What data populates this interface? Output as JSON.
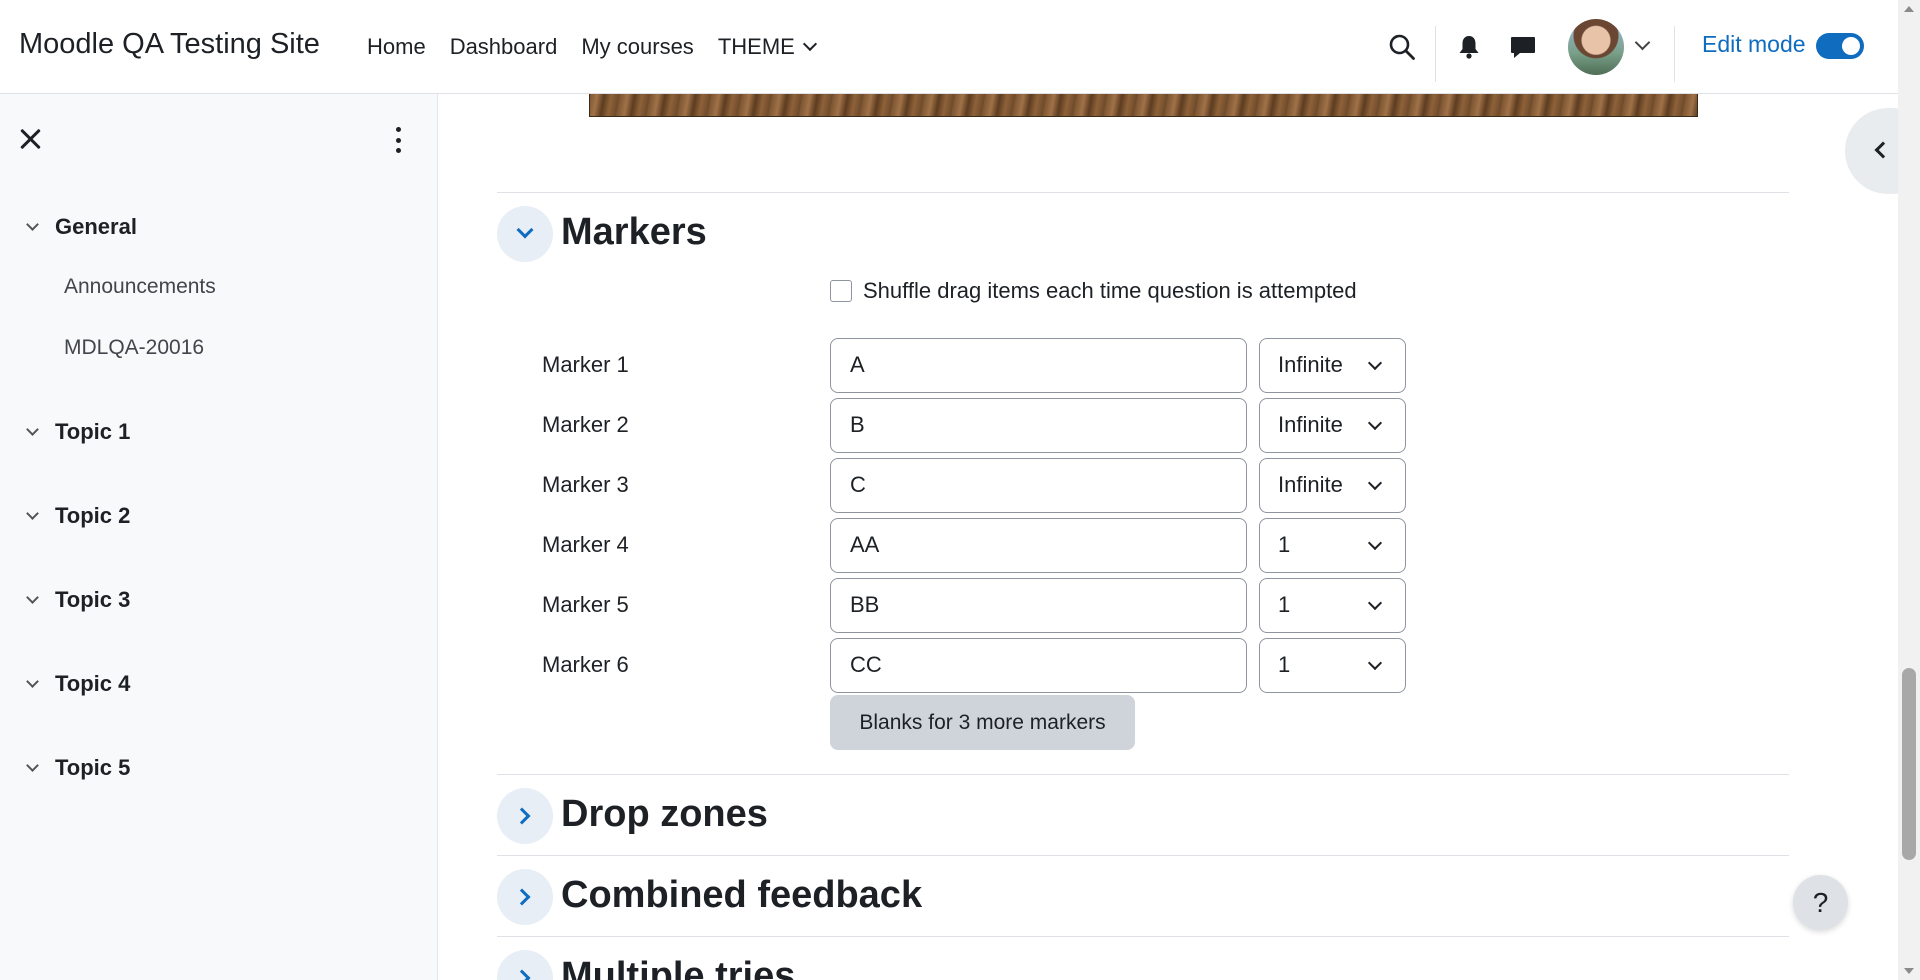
{
  "site": {
    "name": "Moodle QA Testing Site"
  },
  "nav": {
    "items": [
      {
        "label": "Home"
      },
      {
        "label": "Dashboard"
      },
      {
        "label": "My courses"
      },
      {
        "label": "THEME"
      }
    ],
    "edit_mode_label": "Edit mode",
    "edit_mode_on": true
  },
  "drawer": {
    "sections": [
      {
        "label": "General",
        "activities": [
          "Announcements",
          "MDLQA-20016"
        ]
      },
      {
        "label": "Topic 1"
      },
      {
        "label": "Topic 2"
      },
      {
        "label": "Topic 3"
      },
      {
        "label": "Topic 4"
      },
      {
        "label": "Topic 5"
      }
    ]
  },
  "markers_section": {
    "heading": "Markers",
    "shuffle_label": "Shuffle drag items each time question is attempted",
    "shuffle_checked": false,
    "markers": [
      {
        "label": "Marker 1",
        "value": "A",
        "count": "Infinite"
      },
      {
        "label": "Marker 2",
        "value": "B",
        "count": "Infinite"
      },
      {
        "label": "Marker 3",
        "value": "C",
        "count": "Infinite"
      },
      {
        "label": "Marker 4",
        "value": "AA",
        "count": "1"
      },
      {
        "label": "Marker 5",
        "value": "BB",
        "count": "1"
      },
      {
        "label": "Marker 6",
        "value": "CC",
        "count": "1"
      }
    ],
    "blanks_button": "Blanks for 3 more markers"
  },
  "collapsed_sections": [
    {
      "heading": "Drop zones"
    },
    {
      "heading": "Combined feedback"
    },
    {
      "heading": "Multiple tries"
    }
  ],
  "help_label": "?",
  "colors": {
    "accent": "#0f6cbf",
    "drawer_bg": "#f8f9fa",
    "button_bg": "#ced4da"
  }
}
